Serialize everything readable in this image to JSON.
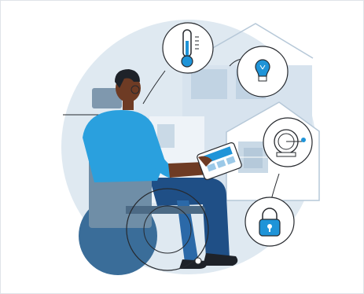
{
  "illustration": {
    "icons": [
      "thermometer-icon",
      "lightbulb-icon",
      "bell-icon",
      "lock-icon"
    ],
    "colors": {
      "backdrop": "#dfe9f1",
      "house": "#c9d9e6",
      "accent_blue": "#1f94d8",
      "shirt": "#2aa0de",
      "skin": "#6e3b24",
      "hair": "#1e2229",
      "pants": "#1f4f86",
      "wheelchair": "#6f8ea7",
      "wheel": "#3a6d99",
      "outline": "#26292e"
    }
  }
}
